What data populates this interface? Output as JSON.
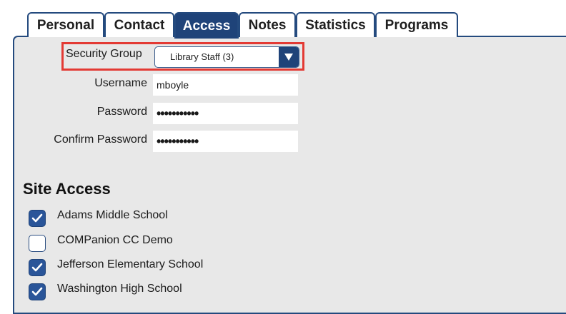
{
  "tabs": [
    {
      "label": "Personal",
      "active": false
    },
    {
      "label": "Contact",
      "active": false
    },
    {
      "label": "Access",
      "active": true
    },
    {
      "label": "Notes",
      "active": false
    },
    {
      "label": "Statistics",
      "active": false
    },
    {
      "label": "Programs",
      "active": false
    }
  ],
  "form": {
    "security_group": {
      "label": "Security Group",
      "value": "Library Staff (3)"
    },
    "username": {
      "label": "Username",
      "value": "mboyle"
    },
    "password": {
      "label": "Password",
      "value": "•••••••••••"
    },
    "confirm_password": {
      "label": "Confirm Password",
      "value": "•••••••••••"
    }
  },
  "site_access": {
    "title": "Site Access",
    "sites": [
      {
        "label": "Adams Middle School",
        "checked": true
      },
      {
        "label": "COMPanion CC Demo",
        "checked": false
      },
      {
        "label": "Jefferson Elementary School",
        "checked": true
      },
      {
        "label": "Washington High School",
        "checked": true
      }
    ]
  },
  "colors": {
    "accent": "#1f4379",
    "highlight": "#e33a34",
    "panel_bg": "#e8e8e8"
  }
}
